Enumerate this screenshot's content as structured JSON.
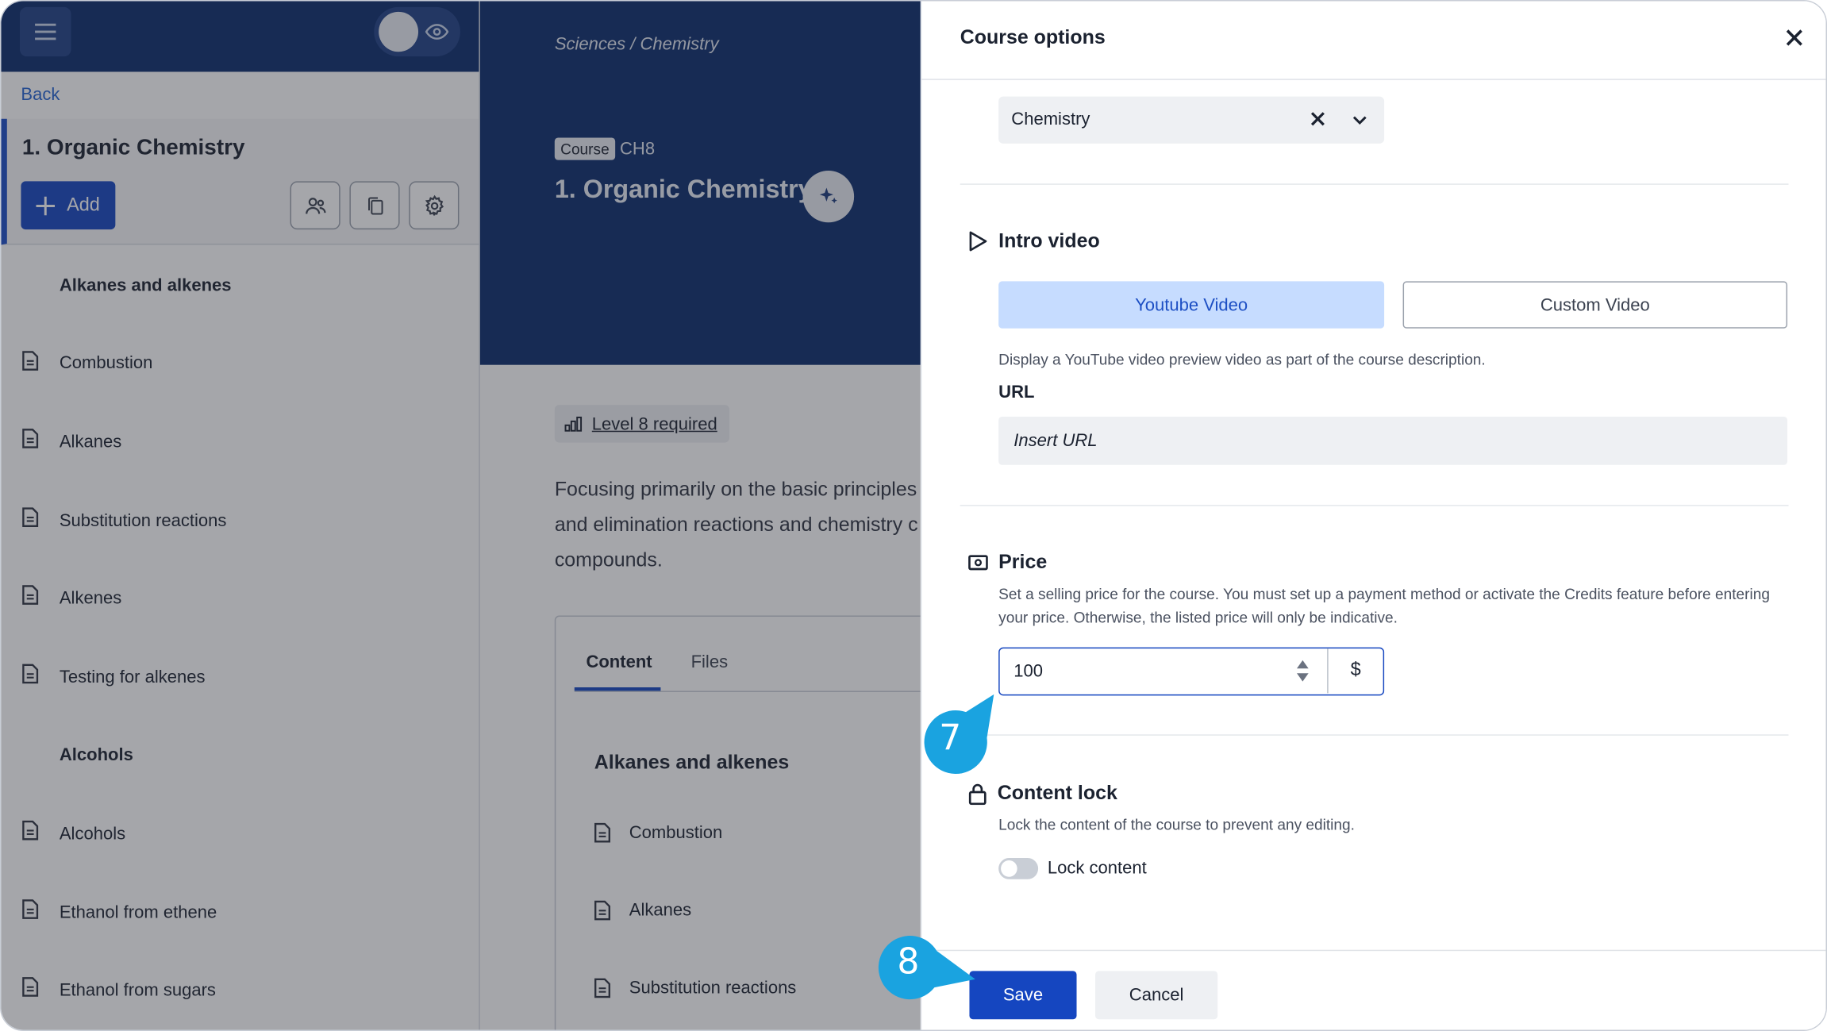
{
  "sidebar": {
    "back_label": "Back",
    "course_title": "1. Organic Chemistry",
    "add_label": "Add",
    "items": [
      {
        "label": "Alkanes and alkenes",
        "type": "section"
      },
      {
        "label": "Combustion",
        "type": "lesson"
      },
      {
        "label": "Alkanes",
        "type": "lesson"
      },
      {
        "label": "Substitution reactions",
        "type": "lesson"
      },
      {
        "label": "Alkenes",
        "type": "lesson"
      },
      {
        "label": "Testing for alkenes",
        "type": "lesson"
      },
      {
        "label": "Alcohols",
        "type": "section"
      },
      {
        "label": "Alcohols",
        "type": "lesson"
      },
      {
        "label": "Ethanol from ethene",
        "type": "lesson"
      },
      {
        "label": "Ethanol from sugars",
        "type": "lesson"
      }
    ]
  },
  "course": {
    "breadcrumb": "Sciences / Chemistry",
    "badge": "Course",
    "code": "CH8",
    "title": "1. Organic Chemistry",
    "level_requirement": "Level 8 required",
    "description_lines": [
      "Focusing primarily on the basic principles",
      "and elimination reactions and chemistry c",
      "compounds."
    ],
    "tabs": [
      "Content",
      "Files"
    ],
    "content_section": "Alkanes and alkenes",
    "content_items": [
      "Combustion",
      "Alkanes",
      "Substitution reactions"
    ]
  },
  "modal": {
    "title": "Course options",
    "subject_value": "Chemistry",
    "intro_video": {
      "heading": "Intro video",
      "youtube_label": "Youtube Video",
      "custom_label": "Custom Video",
      "description": "Display a YouTube video preview video as part of the course description.",
      "url_label": "URL",
      "url_placeholder": "Insert URL"
    },
    "price": {
      "heading": "Price",
      "description": "Set a selling price for the course. You must set up a payment method or activate the Credits feature before entering your price. Otherwise, the listed price will only be indicative.",
      "value": "100",
      "currency": "$"
    },
    "content_lock": {
      "heading": "Content lock",
      "description": "Lock the content of the course to prevent any editing.",
      "toggle_label": "Lock content",
      "enabled": false
    },
    "save_label": "Save",
    "cancel_label": "Cancel"
  },
  "callouts": {
    "step_7": "7",
    "step_8": "8"
  },
  "colors": {
    "navy": "#0b2b6b",
    "primary": "#1546c0",
    "youtube_selected_bg": "#c6dcff",
    "callout": "#1aa3e0"
  }
}
